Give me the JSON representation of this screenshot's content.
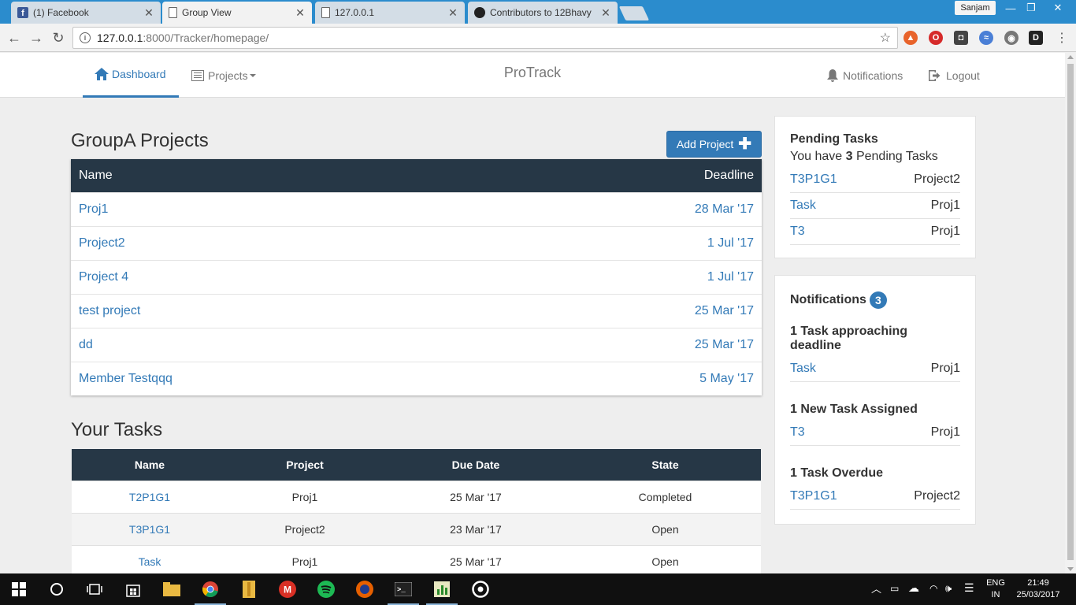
{
  "browser": {
    "tabs": [
      {
        "title": "(1) Facebook",
        "icon": "facebook-icon"
      },
      {
        "title": "Group View",
        "icon": "page-icon"
      },
      {
        "title": "127.0.0.1",
        "icon": "page-icon"
      },
      {
        "title": "Contributors to 12Bhavy",
        "icon": "github-icon"
      }
    ],
    "user_label": "Sanjam",
    "url_host": "127.0.0.1",
    "url_path": ":8000/Tracker/homepage/"
  },
  "nav": {
    "dashboard": "Dashboard",
    "projects": "Projects",
    "brand": "ProTrack",
    "notifications": "Notifications",
    "logout": "Logout"
  },
  "projects": {
    "title": "GroupA Projects",
    "add_label": "Add Project",
    "headers": {
      "name": "Name",
      "deadline": "Deadline"
    },
    "rows": [
      {
        "name": "Proj1",
        "deadline": "28 Mar '17"
      },
      {
        "name": "Project2",
        "deadline": "1 Jul '17"
      },
      {
        "name": "Project 4",
        "deadline": "1 Jul '17"
      },
      {
        "name": "test project",
        "deadline": "25 Mar '17"
      },
      {
        "name": "dd",
        "deadline": "25 Mar '17"
      },
      {
        "name": "Member Testqqq",
        "deadline": "5 May '17"
      }
    ]
  },
  "tasks": {
    "title": "Your Tasks",
    "headers": {
      "name": "Name",
      "project": "Project",
      "due": "Due Date",
      "state": "State"
    },
    "rows": [
      {
        "name": "T2P1G1",
        "project": "Proj1",
        "due": "25 Mar '17",
        "state": "Completed"
      },
      {
        "name": "T3P1G1",
        "project": "Project2",
        "due": "23 Mar '17",
        "state": "Open"
      },
      {
        "name": "Task",
        "project": "Proj1",
        "due": "25 Mar '17",
        "state": "Open"
      }
    ]
  },
  "pending": {
    "title": "Pending Tasks",
    "prefix": "You have ",
    "count": "3",
    "suffix": " Pending Tasks",
    "rows": [
      {
        "task": "T3P1G1",
        "project": "Project2"
      },
      {
        "task": "Task",
        "project": "Proj1"
      },
      {
        "task": "T3",
        "project": "Proj1"
      }
    ]
  },
  "notifications": {
    "title": "Notifications",
    "count": "3",
    "groups": [
      {
        "heading": "1 Task approaching deadline",
        "task": "Task",
        "project": "Proj1"
      },
      {
        "heading": "1 New Task Assigned",
        "task": "T3",
        "project": "Proj1"
      },
      {
        "heading": "1 Task Overdue",
        "task": "T3P1G1",
        "project": "Project2"
      }
    ]
  },
  "taskbar": {
    "language": "ENG",
    "region": "IN",
    "time": "21:49",
    "date": "25/03/2017"
  },
  "colors": {
    "accent": "#337ab7",
    "table_header": "#263746",
    "tab_strip": "#2b8ccd"
  }
}
